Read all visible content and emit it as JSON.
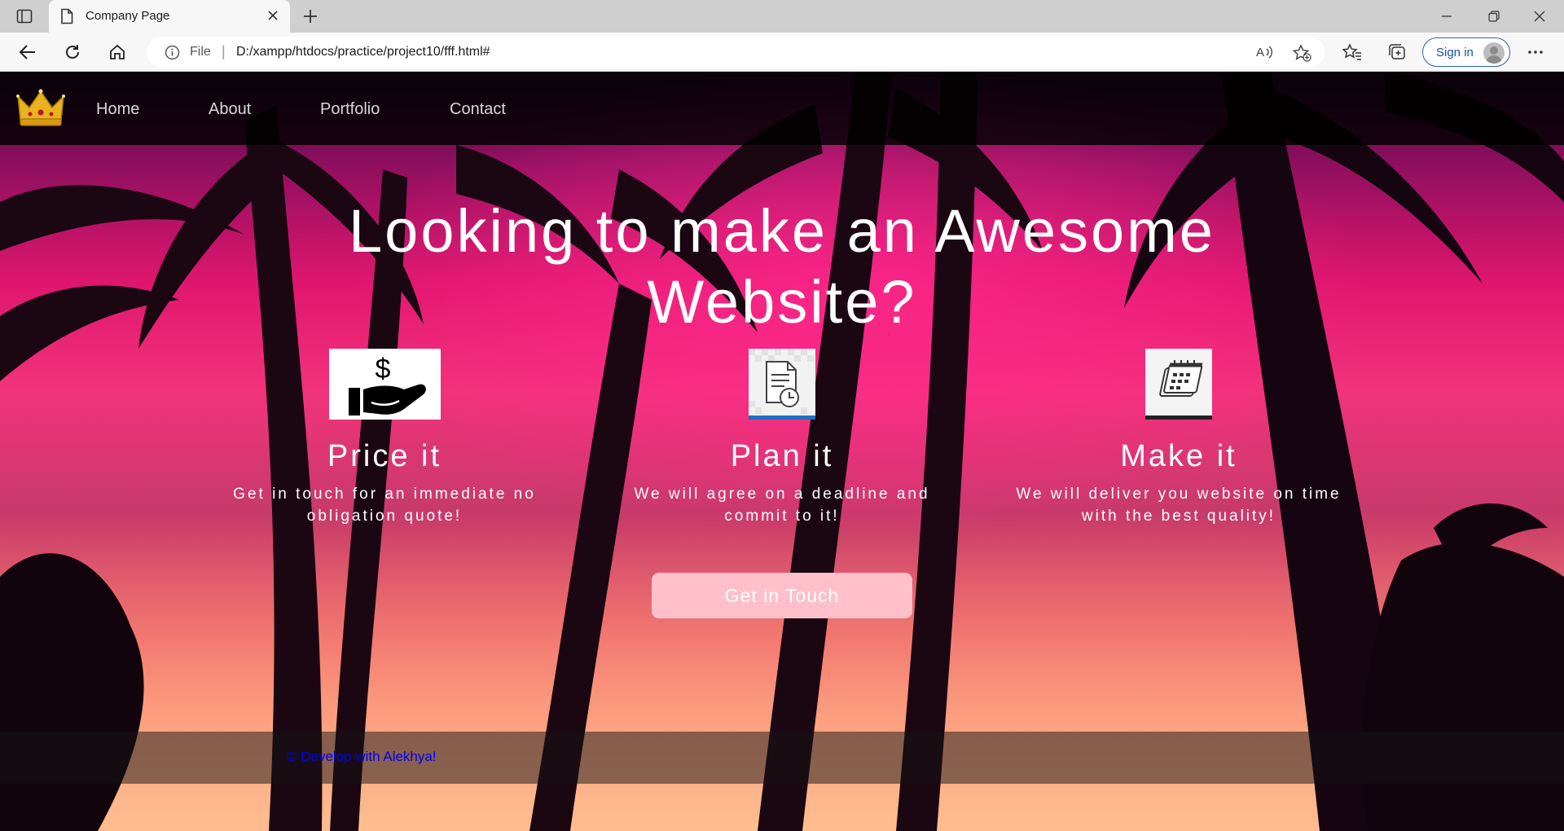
{
  "browser": {
    "tab_title": "Company Page",
    "address": {
      "scheme_label": "File",
      "url": "D:/xampp/htdocs/practice/project10/fff.html#"
    },
    "signin_label": "Sign in"
  },
  "site": {
    "nav": {
      "items": [
        {
          "label": "Home"
        },
        {
          "label": "About"
        },
        {
          "label": "Portfolio"
        },
        {
          "label": "Contact"
        }
      ]
    },
    "hero": {
      "title_line1": "Looking to make an Awesome",
      "title_line2": "Website?"
    },
    "features": [
      {
        "icon": "dollar-hand-icon",
        "title": "Price it",
        "desc": "Get in touch for an immediate no obligation quote!"
      },
      {
        "icon": "document-clock-icon",
        "title": "Plan it",
        "desc": "We will agree on a deadline and commit to it!"
      },
      {
        "icon": "calendar-icon",
        "title": "Make it",
        "desc": "We will deliver you website on time with the best quality!"
      }
    ],
    "cta_label": "Get in Touch",
    "footer_text": "© Develop with Alekhya!",
    "colors": {
      "nav_bg": "#000000",
      "cta_bg": "#ffc0cb",
      "footer_link": "#0000ee"
    }
  }
}
